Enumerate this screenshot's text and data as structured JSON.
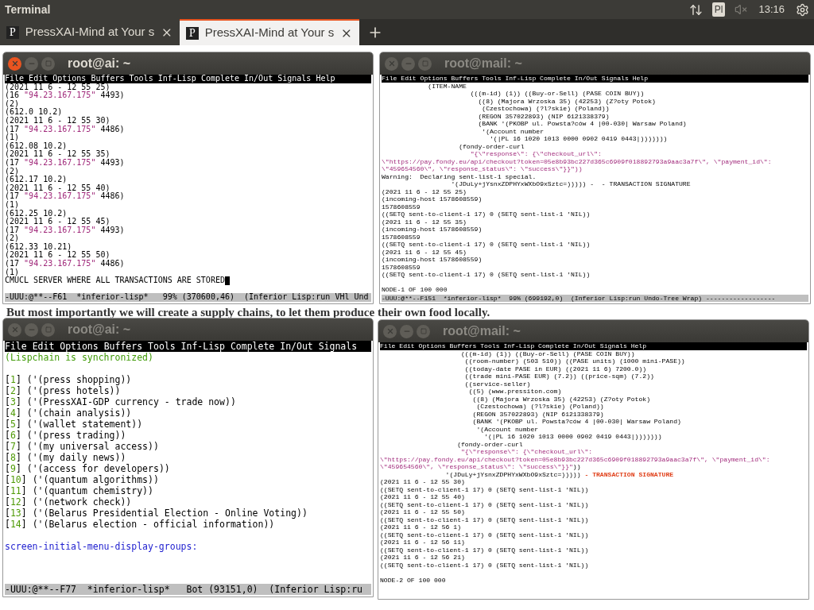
{
  "top_bar": {
    "title": "Terminal",
    "keyboard": "Pl",
    "time": "13:16"
  },
  "tabs": [
    {
      "favicon": "P",
      "label": "PressXAI-Mind at Your s",
      "selected": false
    },
    {
      "favicon": "P",
      "label": "PressXAI-Mind at Your s",
      "selected": true
    }
  ],
  "page": {
    "text": "But most importantly we will create a supply chains, to let them produce their own food locally."
  },
  "windows": [
    {
      "title": "root@ai: ~",
      "focused": true,
      "menu": [
        "File",
        "Edit",
        "Options",
        "Buffers",
        "Tools",
        "Inf-Lisp",
        "Complete",
        "In/Out",
        "Signals",
        "Help"
      ],
      "lines": [
        "(2021 11 6 - 12 55 25)",
        [
          {
            "kind": "plain",
            "text": "(16 "
          },
          {
            "kind": "string",
            "text": "\"94.23.167.175\""
          },
          {
            "kind": "plain",
            "text": " 4493)"
          }
        ],
        "(2)",
        "(612.0 10.2)",
        "(2021 11 6 - 12 55 30)",
        [
          {
            "kind": "plain",
            "text": "(17 "
          },
          {
            "kind": "string",
            "text": "\"94.23.167.175\""
          },
          {
            "kind": "plain",
            "text": " 4486)"
          }
        ],
        "(1)",
        "(612.08 10.2)",
        "(2021 11 6 - 12 55 35)",
        [
          {
            "kind": "plain",
            "text": "(17 "
          },
          {
            "kind": "string",
            "text": "\"94.23.167.175\""
          },
          {
            "kind": "plain",
            "text": " 4493)"
          }
        ],
        "(2)",
        "(612.17 10.2)",
        "(2021 11 6 - 12 55 40)",
        [
          {
            "kind": "plain",
            "text": "(17 "
          },
          {
            "kind": "string",
            "text": "\"94.23.167.175\""
          },
          {
            "kind": "plain",
            "text": " 4486)"
          }
        ],
        "(1)",
        "(612.25 10.2)",
        "(2021 11 6 - 12 55 45)",
        [
          {
            "kind": "plain",
            "text": "(17 "
          },
          {
            "kind": "string",
            "text": "\"94.23.167.175\""
          },
          {
            "kind": "plain",
            "text": " 4493)"
          }
        ],
        "(2)",
        "(612.33 10.21)",
        "(2021 11 6 - 12 55 50)",
        [
          {
            "kind": "plain",
            "text": "(17 "
          },
          {
            "kind": "string",
            "text": "\"94.23.167.175\""
          },
          {
            "kind": "plain",
            "text": " 4486)"
          }
        ],
        "(1)",
        {
          "text": "CMUCL SERVER WHERE ALL TRANSACTIONS ARE STORED",
          "cursor": true
        }
      ],
      "mode_line": "-UUU:@**--F61  *inferior-lisp*   99% (370600,46)  (Inferior Lisp:run VHl Und"
    },
    {
      "title": "root@mail: ~",
      "focused": false,
      "menu": [
        "File",
        "Edit",
        "Options",
        "Buffers",
        "Tools",
        "Inf-Lisp",
        "Complete",
        "In/Out",
        "Signals",
        "Help"
      ],
      "lines": [
        "            (ITEM-NAME",
        "                       (((m-id) (1)) ((Buy-or-Sell) (PASE COIN BUY))",
        "                         ((8) (Majora Wrzoska 35) (42253) (Z?oty Potok)",
        "                          (Czestochowa) (?l?skie) (Poland))",
        "                         (REGON 357022893) (NIP 6121338379)",
        "                         (BANK '(PKOBP ul. Powsta?ców 4 |00-030| Warsaw Poland)",
        "                          '(Account number",
        "                            '(|PL 16 1020 1013 0000 0902 0419 0443|)))))))",
        "                    (fondy-order-curl",
        [
          {
            "kind": "string",
            "text": "                       \"{\\\"response\\\": {\\\"checkout_url\\\":"
          }
        ],
        [
          {
            "kind": "string",
            "text": "\\\"https://pay.fondy.eu/api/checkout?token=05e8b93bc227d365c6909f018892793a9aac3a7f\\\", \\\"payment_id\\\":"
          }
        ],
        [
          {
            "kind": "string",
            "text": "\\\"459654560\\\", \\\"response_status\\\": \\\"success\\\"}}\"))"
          }
        ],
        "Warning:  Declaring sent-list-1 special.",
        "                  '(JDuLy+jYsnxZDPHYxWXbO9xSztc=))))) -  - TRANSACTION SIGNATURE",
        "(2021 11 6 - 12 55 25)",
        "(incoming-host 1578608559)",
        "1578608559",
        "((SETQ sent-to-client-1 17) 0 (SETQ sent-list-1 'NIL))",
        "(2021 11 6 - 12 55 35)",
        "(incoming-host 1578608559)",
        "1578608559",
        "((SETQ sent-to-client-1 17) 0 (SETQ sent-list-1 'NIL))",
        "(2021 11 6 - 12 55 45)",
        "(incoming-host 1578608559)",
        "1578608559",
        "((SETQ sent-to-client-1 17) 0 (SETQ sent-list-1 'NIL))",
        {
          "kind": "blank"
        },
        "NODE-1 OF 100 000"
      ],
      "mode_line": "-UUU:@**--F151  *inferior-lisp*  99% (699192,0)  (Inferior Lisp:run Undo-Tree Wrap) ------------------"
    },
    {
      "title": "root@ai: ~",
      "focused": false,
      "menu": [
        "File",
        "Edit",
        "Options",
        "Buffers",
        "Tools",
        "Inf-Lisp",
        "Complete",
        "In/Out",
        "Signals"
      ],
      "lines": [
        [
          {
            "kind": "status",
            "text": "(Lispchain is synchronized)"
          }
        ],
        {
          "kind": "blank"
        },
        [
          {
            "kind": "plain",
            "text": "["
          },
          {
            "kind": "index",
            "text": "1"
          },
          {
            "kind": "plain",
            "text": "] ('(press shopping))"
          }
        ],
        [
          {
            "kind": "plain",
            "text": "["
          },
          {
            "kind": "index",
            "text": "2"
          },
          {
            "kind": "plain",
            "text": "] ('(press hotels))"
          }
        ],
        [
          {
            "kind": "plain",
            "text": "["
          },
          {
            "kind": "index",
            "text": "3"
          },
          {
            "kind": "plain",
            "text": "] ('(PressXAI-GDP currency - trade now))"
          }
        ],
        [
          {
            "kind": "plain",
            "text": "["
          },
          {
            "kind": "index",
            "text": "4"
          },
          {
            "kind": "plain",
            "text": "] ('(chain analysis))"
          }
        ],
        [
          {
            "kind": "plain",
            "text": "["
          },
          {
            "kind": "index",
            "text": "5"
          },
          {
            "kind": "plain",
            "text": "] ('(wallet statement))"
          }
        ],
        [
          {
            "kind": "plain",
            "text": "["
          },
          {
            "kind": "index",
            "text": "6"
          },
          {
            "kind": "plain",
            "text": "] ('(press trading))"
          }
        ],
        [
          {
            "kind": "plain",
            "text": "["
          },
          {
            "kind": "index",
            "text": "7"
          },
          {
            "kind": "plain",
            "text": "] ('(my universal access))"
          }
        ],
        [
          {
            "kind": "plain",
            "text": "["
          },
          {
            "kind": "index",
            "text": "8"
          },
          {
            "kind": "plain",
            "text": "] ('(my daily news))"
          }
        ],
        [
          {
            "kind": "plain",
            "text": "["
          },
          {
            "kind": "index",
            "text": "9"
          },
          {
            "kind": "plain",
            "text": "] ('(access for developers))"
          }
        ],
        [
          {
            "kind": "plain",
            "text": "["
          },
          {
            "kind": "index",
            "text": "10"
          },
          {
            "kind": "plain",
            "text": "] ('(quantum algorithms))"
          }
        ],
        [
          {
            "kind": "plain",
            "text": "["
          },
          {
            "kind": "index",
            "text": "11"
          },
          {
            "kind": "plain",
            "text": "] ('(quantum chemistry))"
          }
        ],
        [
          {
            "kind": "plain",
            "text": "["
          },
          {
            "kind": "index",
            "text": "12"
          },
          {
            "kind": "plain",
            "text": "] ('(network check))"
          }
        ],
        [
          {
            "kind": "plain",
            "text": "["
          },
          {
            "kind": "index",
            "text": "13"
          },
          {
            "kind": "plain",
            "text": "] ('(Belarus Presidential Election - Online Voting))"
          }
        ],
        [
          {
            "kind": "plain",
            "text": "["
          },
          {
            "kind": "index",
            "text": "14"
          },
          {
            "kind": "plain",
            "text": "] ('(Belarus election - official information))"
          }
        ],
        {
          "kind": "blank"
        },
        [
          {
            "kind": "keyword",
            "text": "screen-initial-menu-display-groups:"
          }
        ],
        {
          "kind": "blank"
        },
        {
          "kind": "blank"
        }
      ],
      "mode_line": "-UUU:@**--F77  *inferior-lisp*   Bot (93151,0)  (Inferior Lisp:ru"
    },
    {
      "title": "root@mail: ~",
      "focused": false,
      "menu": [
        "File",
        "Edit",
        "Options",
        "Buffers",
        "Tools",
        "Inf-Lisp",
        "Complete",
        "In/Out",
        "Signals",
        "Help"
      ],
      "lines": [
        "                     (((m-id) (1)) ((Buy-or-Sell) (PASE COIN BUY))",
        "                      ((room-number) (503 510)) ((PASE units) (1000 mini-PASE))",
        "                      ((today-date PASE in EUR) ((2021 11 6) 7200.0))",
        "                      ((trade mini-PASE EUR) (7.2)) ((price-sqm) (7.2))",
        "                      ((service-seller)",
        "                       ((5) (www.pressiton.com)",
        "                        ((8) (Majora Wrzoska 35) (42253) (Z?oty Potok)",
        "                         (Czestochowa) (?l?skie) (Poland))",
        "                        (REGON 357022893) (NIP 6121338379)",
        "                        (BANK '(PKOBP ul. Powsta?ców 4 |00-030| Warsaw Poland)",
        "                         '(Account number",
        "                           '(|PL 16 1020 1013 0000 0902 0419 0443|)))))))",
        "                    (fondy-order-curl",
        [
          {
            "kind": "string",
            "text": "                     \"{\\\"response\\\": {\\\"checkout_url\\\":"
          }
        ],
        [
          {
            "kind": "string",
            "text": "\\\"https://pay.fondy.eu/api/checkout?token=05e8b93bc227d365c6909f018892793a9aac3a7f\\\", \\\"payment_id\\\":"
          }
        ],
        [
          {
            "kind": "string",
            "text": "\\\"459654560\\\", \\\"response_status\\\": \\\"success\\\"}}\""
          },
          {
            "kind": "plain",
            "text": "))"
          }
        ],
        [
          {
            "kind": "plain",
            "text": "                 '(JDuLy+jYsnxZDPHYxWXbO9xSztc=))))) "
          },
          {
            "kind": "signature",
            "text": "- TRANSACTION SIGNATURE"
          }
        ],
        "(2021 11 6 - 12 55 30)",
        "((SETQ sent-to-client-1 17) 0 (SETQ sent-list-1 'NIL))",
        "(2021 11 6 - 12 55 40)",
        "((SETQ sent-to-client-1 17) 0 (SETQ sent-list-1 'NIL))",
        "(2021 11 6 - 12 55 50)",
        "((SETQ sent-to-client-1 17) 0 (SETQ sent-list-1 'NIL))",
        "(2021 11 6 - 12 56 1)",
        "((SETQ sent-to-client-1 17) 0 (SETQ sent-list-1 'NIL))",
        "(2021 11 6 - 12 56 11)",
        "((SETQ sent-to-client-1 17) 0 (SETQ sent-list-1 'NIL))",
        "(2021 11 6 - 12 56 21)",
        "((SETQ sent-to-client-1 17) 0 (SETQ sent-list-1 'NIL))",
        {
          "kind": "blank"
        },
        "NODE-2 OF 100 000"
      ]
    }
  ]
}
